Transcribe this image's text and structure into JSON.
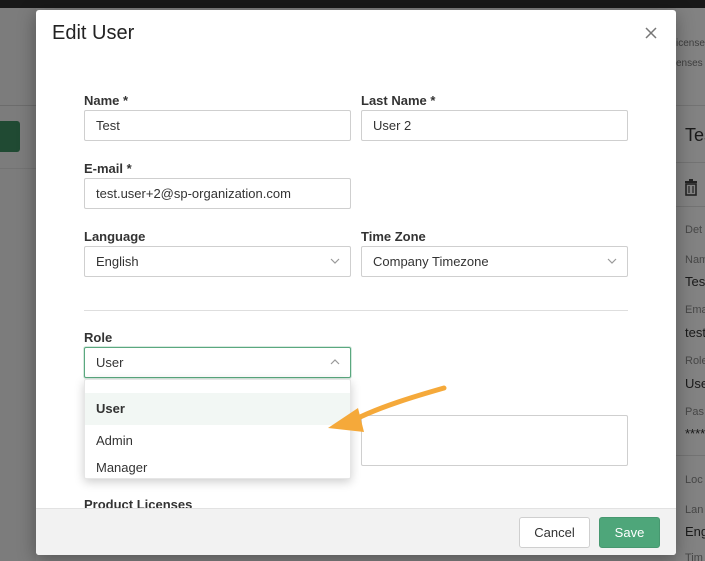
{
  "background": {
    "right_panel": {
      "license_lines": [
        "icense",
        "enses"
      ],
      "title": "Tes",
      "section_details": "Det",
      "name_label": "Nam",
      "name_value": "Tes",
      "email_label": "Ema",
      "email_value": "test",
      "role_label": "Role",
      "role_value": "Use",
      "password_label": "Pas",
      "password_value": "*****",
      "section_locale": "Loc",
      "language_label": "Lan",
      "language_value": "Eng",
      "timezone_label": "Tim"
    }
  },
  "modal": {
    "title": "Edit User",
    "fields": {
      "name": {
        "label": "Name *",
        "value": "Test"
      },
      "last_name": {
        "label": "Last Name *",
        "value": "User 2"
      },
      "email": {
        "label": "E-mail *",
        "value": "test.user+2@sp-organization.com"
      },
      "language": {
        "label": "Language",
        "value": "English"
      },
      "time_zone": {
        "label": "Time Zone",
        "value": "Company Timezone"
      },
      "role": {
        "label": "Role",
        "value": "User",
        "options": [
          "User",
          "Admin",
          "Manager"
        ]
      }
    },
    "product_licenses_label": "Product Licenses",
    "footer": {
      "cancel_label": "Cancel",
      "save_label": "Save"
    }
  },
  "colors": {
    "accent": "#4ea67a",
    "arrow": "#f5a93a"
  }
}
